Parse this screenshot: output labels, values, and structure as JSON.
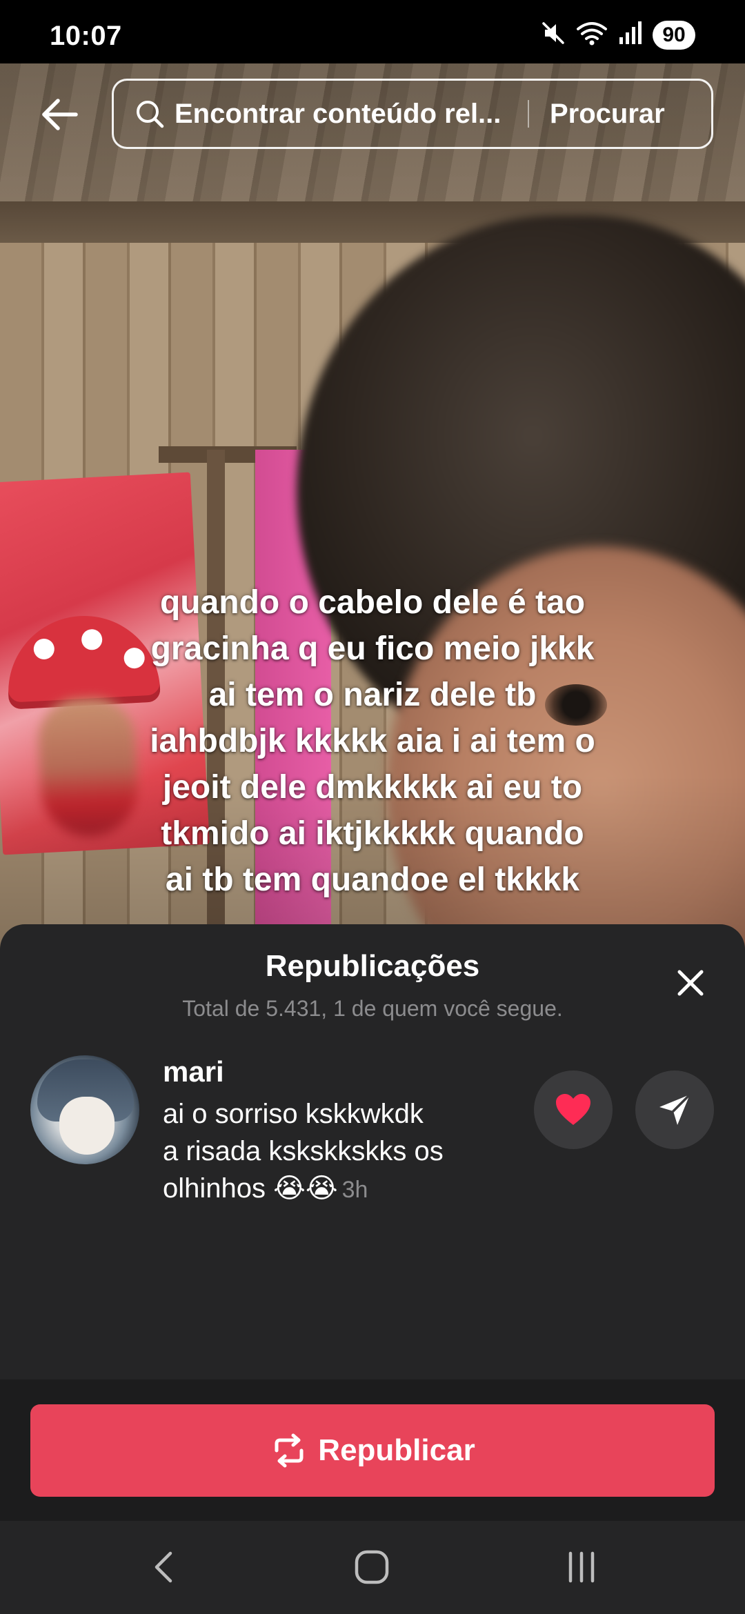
{
  "status_bar": {
    "time": "10:07",
    "battery": "90",
    "icons": [
      "mute-icon",
      "wifi-icon",
      "signal-icon"
    ]
  },
  "header": {
    "search_placeholder": "Encontrar conteúdo rel...",
    "search_button": "Procurar"
  },
  "video": {
    "caption_lines": [
      "quando o cabelo dele é tao",
      "gracinha q eu fico meio jkkk",
      "ai tem o nariz dele tb",
      "iahbdbjk kkkkk aia i ai tem o",
      "jeoit dele dmkkkkk ai eu to",
      "tkmido ai iktjkkkkk quando",
      "ai tb tem quandoe el tkkkk"
    ]
  },
  "sheet": {
    "title": "Republicações",
    "subtitle": "Total de 5.431, 1 de quem você segue.",
    "items": [
      {
        "name": "mari",
        "text_lines": [
          "ai o sorriso kskkwkdk",
          "a risada kskskkskks os",
          "olhinhos 😭😭"
        ],
        "time": "3h"
      }
    ]
  },
  "republish_button": "Republicar",
  "colors": {
    "accent": "#e8445a",
    "sheet_bg": "#252526",
    "muted_text": "#8c8c8e"
  }
}
